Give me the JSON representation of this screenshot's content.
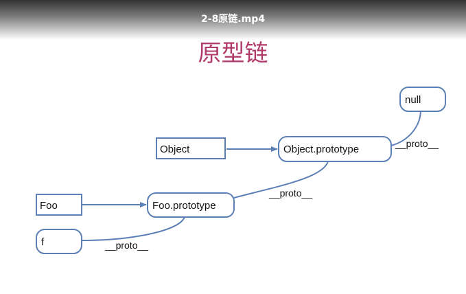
{
  "video": {
    "title": "2-8原链.mp4"
  },
  "slide": {
    "title": "原型链"
  },
  "diagram": {
    "nodes": {
      "null": "null",
      "object": "Object",
      "object_prototype": "Object.prototype",
      "foo": "Foo",
      "foo_prototype": "Foo.prototype",
      "f": "f"
    },
    "edge_labels": {
      "object_prototype_proto": "__proto__",
      "foo_prototype_proto": "__proto__",
      "f_proto": "__proto__"
    },
    "colors": {
      "stroke": "#5b7fb5",
      "title": "#b03a6a"
    }
  }
}
